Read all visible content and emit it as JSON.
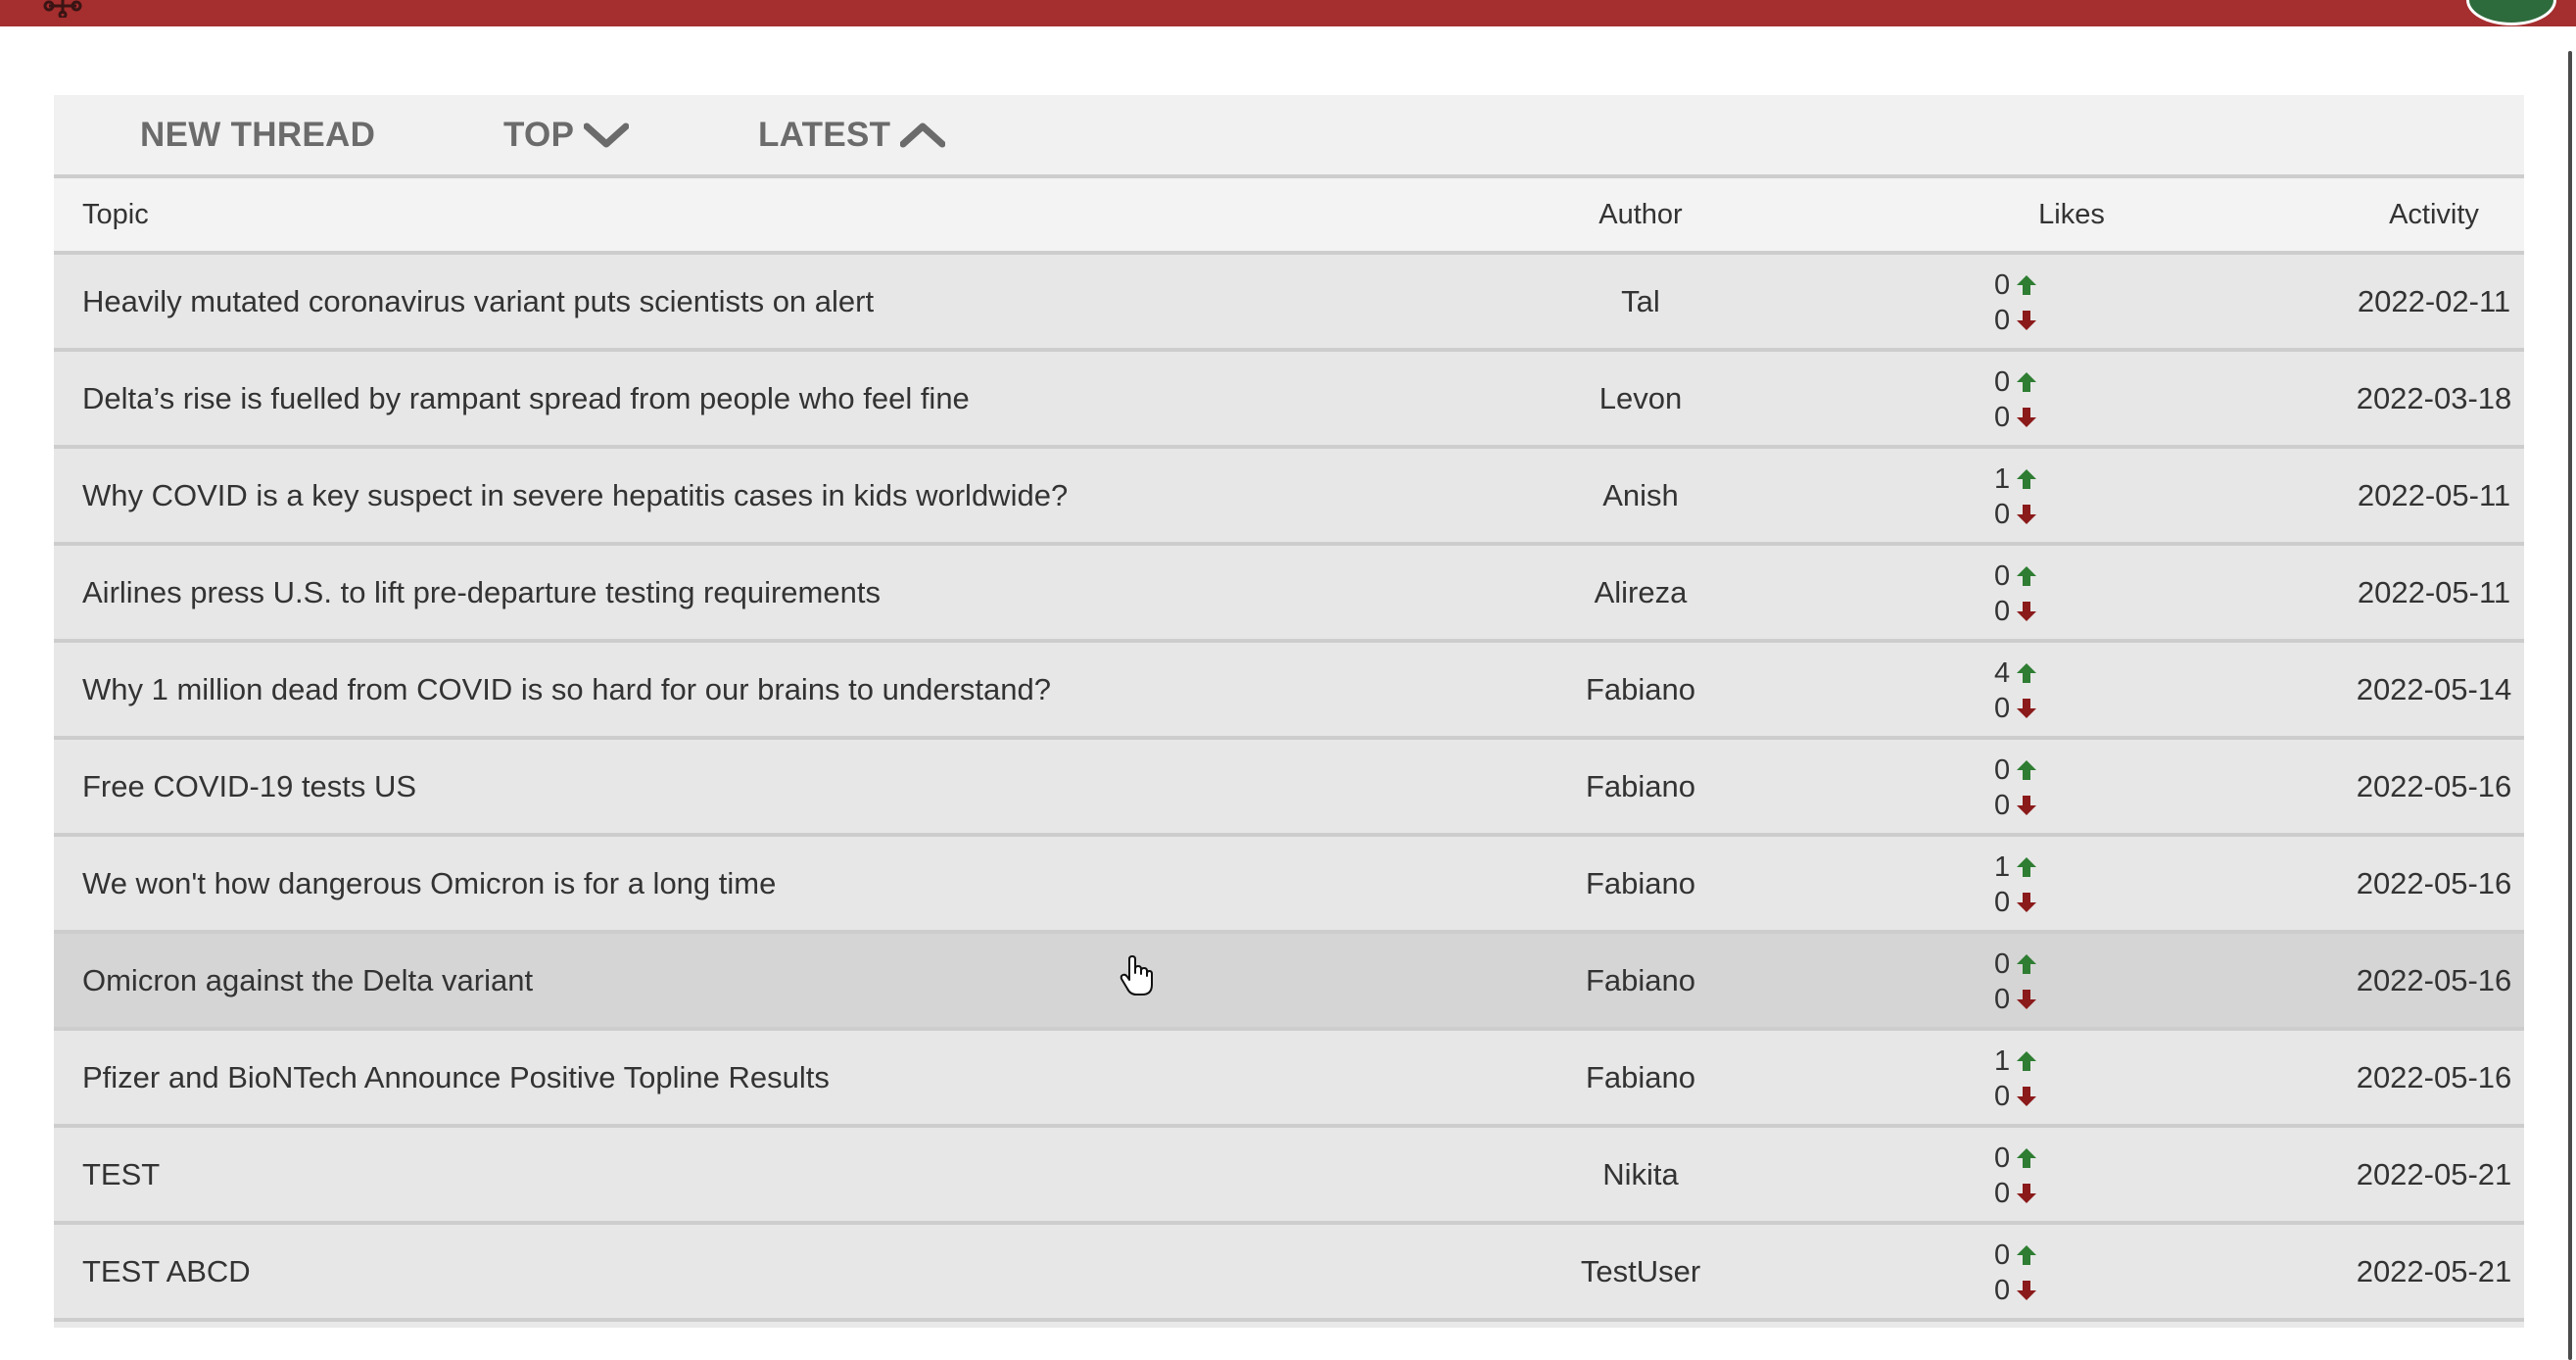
{
  "colors": {
    "topbar": "#a52e2e",
    "avatar": "#2e6b3c",
    "upvote": "#2e7d32",
    "downvote": "#8b1a1a",
    "row_hover": "#d5d5d5"
  },
  "header": {
    "logo_icon": "virus-logo-icon",
    "avatar_icon": "user-avatar"
  },
  "toolbar": {
    "new_thread_label": "NEW THREAD",
    "top_label": "TOP",
    "top_icon": "chevron-down-icon",
    "latest_label": "LATEST",
    "latest_icon": "chevron-up-icon"
  },
  "table": {
    "columns": [
      "Topic",
      "Author",
      "Likes",
      "Activity"
    ],
    "hovered_row": 7,
    "rows": [
      {
        "topic": "Heavily mutated coronavirus variant puts scientists on alert",
        "author": "Tal",
        "up": "0",
        "down": "0",
        "activity": "2022-02-11"
      },
      {
        "topic": "Delta’s rise is fuelled by rampant spread from people who feel fine",
        "author": "Levon",
        "up": "0",
        "down": "0",
        "activity": "2022-03-18"
      },
      {
        "topic": "Why COVID is a key suspect in severe hepatitis cases in kids worldwide?",
        "author": "Anish",
        "up": "1",
        "down": "0",
        "activity": "2022-05-11"
      },
      {
        "topic": "Airlines press U.S. to lift pre-departure testing requirements",
        "author": "Alireza",
        "up": "0",
        "down": "0",
        "activity": "2022-05-11"
      },
      {
        "topic": "Why 1 million dead from COVID is so hard for our brains to understand?",
        "author": "Fabiano",
        "up": "4",
        "down": "0",
        "activity": "2022-05-14"
      },
      {
        "topic": "Free COVID-19 tests US",
        "author": "Fabiano",
        "up": "0",
        "down": "0",
        "activity": "2022-05-16"
      },
      {
        "topic": "We won't how dangerous Omicron is for a long time",
        "author": "Fabiano",
        "up": "1",
        "down": "0",
        "activity": "2022-05-16"
      },
      {
        "topic": "Omicron against the Delta variant",
        "author": "Fabiano",
        "up": "0",
        "down": "0",
        "activity": "2022-05-16"
      },
      {
        "topic": "Pfizer and BioNTech Announce Positive Topline Results",
        "author": "Fabiano",
        "up": "1",
        "down": "0",
        "activity": "2022-05-16"
      },
      {
        "topic": "TEST",
        "author": "Nikita",
        "up": "0",
        "down": "0",
        "activity": "2022-05-21"
      },
      {
        "topic": "TEST ABCD",
        "author": "TestUser",
        "up": "0",
        "down": "0",
        "activity": "2022-05-21"
      }
    ]
  }
}
